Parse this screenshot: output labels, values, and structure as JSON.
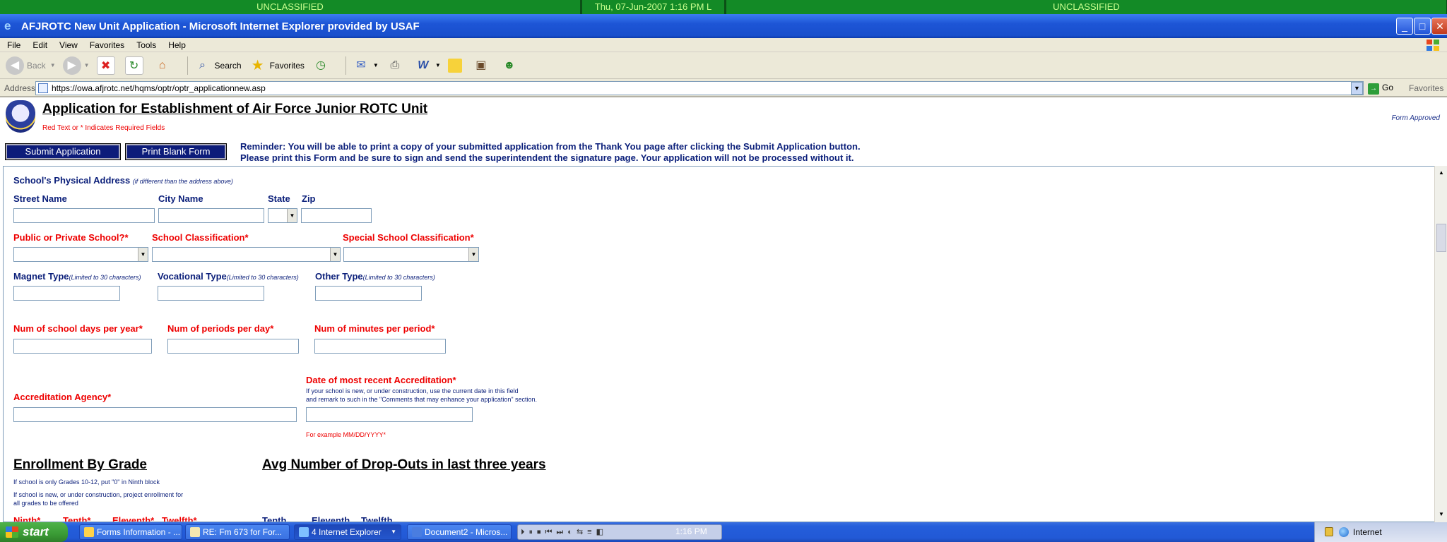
{
  "banner": {
    "left": "UNCLASSIFIED",
    "datetime": "Thu, 07-Jun-2007 1:16 PM L",
    "right": "UNCLASSIFIED"
  },
  "window": {
    "title": "AFJROTC New Unit Application - Microsoft Internet Explorer provided by USAF",
    "minimize": "_",
    "maximize": "□",
    "close": "✕"
  },
  "menu": [
    "File",
    "Edit",
    "View",
    "Favorites",
    "Tools",
    "Help"
  ],
  "toolbar": {
    "back": "Back",
    "search": "Search",
    "favorites": "Favorites"
  },
  "address": {
    "label": "Address",
    "url": "https://owa.afjrotc.net/hqms/optr/optr_applicationnew.asp",
    "go": "Go",
    "favorites": "Favorites"
  },
  "page": {
    "title": "Application for Establishment of Air Force Junior ROTC Unit",
    "required_note": "Red Text or * Indicates Required Fields",
    "form_approved": "Form Approved",
    "submit_button": "Submit Application",
    "print_button": "Print Blank Form",
    "reminder_line1": "Reminder: You will be able to print a copy of your submitted application from the Thank You page after clicking the Submit Application button.",
    "reminder_line2": "Please print this Form and be sure to sign and send the superintendent the signature page. Your application will not be processed without it."
  },
  "form": {
    "physical_address": {
      "heading": "School's Physical Address",
      "heading_note": "(if different than the address above)",
      "street": "Street Name",
      "city": "City Name",
      "state": "State",
      "zip": "Zip"
    },
    "classification": {
      "public_private": "Public or Private School?*",
      "school_class": "School Classification*",
      "special_class": "Special School Classification*"
    },
    "types": {
      "magnet": "Magnet Type",
      "vocational": "Vocational Type",
      "other": "Other Type",
      "limit_note": "(Limited to 30 characters)"
    },
    "schedule": {
      "days": "Num of school days per year*",
      "periods": "Num of periods per day*",
      "minutes": "Num of minutes per period*"
    },
    "accreditation": {
      "agency": "Accreditation Agency*",
      "date": "Date of most recent Accreditation*",
      "date_note1": "If your school is new, or under construction, use the current date in this field",
      "date_note2": "and remark to such in the \"Comments that may enhance your application\" section.",
      "example": "For example MM/DD/YYYY*"
    },
    "enrollment": {
      "heading": "Enrollment By Grade",
      "note1": "If school is only Grades 10-12, put \"0\" in Ninth block",
      "note2": "If school is new, or under construction, project enrollment for",
      "note3": "all grades to be offered",
      "grades": [
        "Ninth*",
        "Tenth*",
        "Eleventh*",
        "Twelfth*"
      ]
    },
    "dropouts": {
      "heading": "Avg Number of Drop-Outs in last three years",
      "grades": [
        "Tenth",
        "Eleventh",
        "Twelfth"
      ]
    }
  },
  "taskbar": {
    "start": "start",
    "tasks": [
      "Forms Information - ...",
      "RE: Fm 673 for For...",
      "4 Internet Explorer",
      "Document2 - Micros..."
    ],
    "clock": "1:16 PM",
    "tray_label": "Internet"
  },
  "colors": {
    "banner_green": "#138a26",
    "label_navy": "#0b1f7a",
    "required_red": "#e00000",
    "button_navy": "#0d1c7a"
  }
}
